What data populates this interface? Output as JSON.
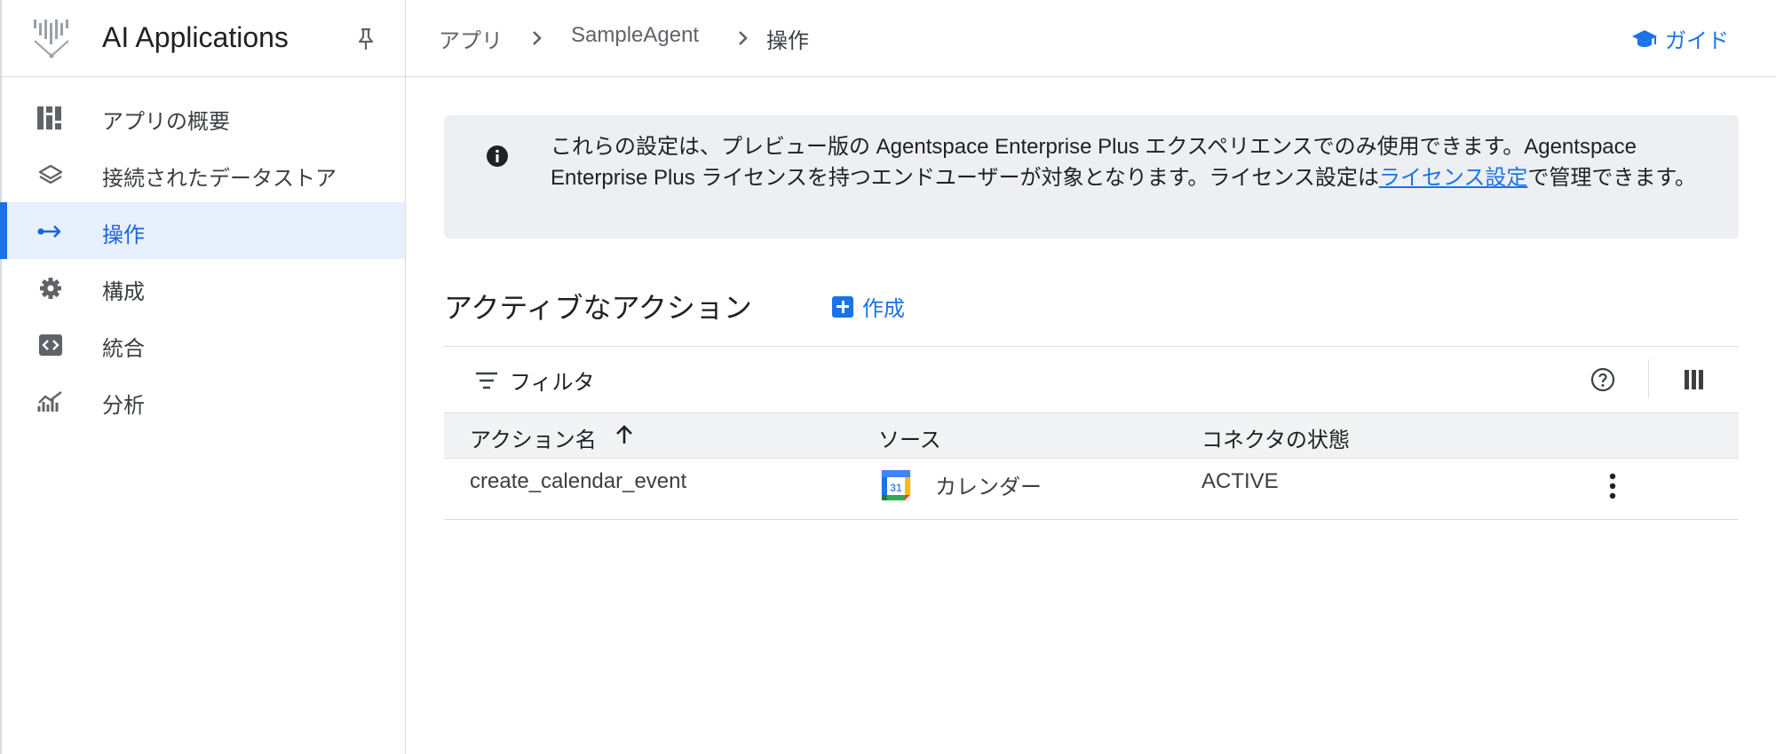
{
  "app": {
    "title": "AI Applications"
  },
  "sidebar": {
    "items": [
      {
        "label": "アプリの概要",
        "icon": "dashboard-icon"
      },
      {
        "label": "接続されたデータストア",
        "icon": "layers-icon"
      },
      {
        "label": "操作",
        "icon": "actions-arrow-icon",
        "active": true
      },
      {
        "label": "構成",
        "icon": "gear-icon"
      },
      {
        "label": "統合",
        "icon": "code-icon"
      },
      {
        "label": "分析",
        "icon": "analytics-icon"
      }
    ]
  },
  "breadcrumb": {
    "items": [
      "アプリ",
      "SampleAgent",
      "操作"
    ]
  },
  "header": {
    "guide_label": "ガイド"
  },
  "banner": {
    "text_before": "これらの設定は、プレビュー版の Agentspace Enterprise Plus エクスペリエンスでのみ使用できます。Agentspace Enterprise Plus ライセンスを持つエンドユーザーが対象となります。ライセンス設定は",
    "link_text": "ライセンス設定",
    "text_after": "で管理できます。"
  },
  "section": {
    "title": "アクティブなアクション",
    "create_label": "作成"
  },
  "table": {
    "filter_label": "フィルタ",
    "columns": [
      "アクション名",
      "ソース",
      "コネクタの状態"
    ],
    "rows": [
      {
        "action_name": "create_calendar_event",
        "source": "カレンダー",
        "source_icon": "google-calendar-icon",
        "status": "ACTIVE"
      }
    ]
  },
  "colors": {
    "accent": "#1a73e8",
    "active_bg": "#e8f0fe",
    "banner_bg": "#edeff2"
  }
}
